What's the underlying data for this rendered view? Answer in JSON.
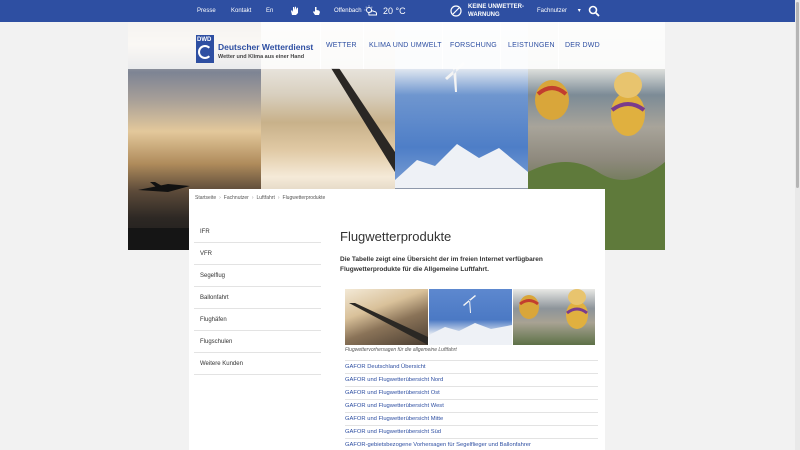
{
  "topbar": {
    "presse": "Presse",
    "kontakt": "Kontakt",
    "lang": "En",
    "city": "Offenbach",
    "temperature": "20 °C",
    "warning_line1": "KEINE UNWETTER-",
    "warning_line2": "WARNUNG",
    "role": "Fachnutzer",
    "role_caret": "▾"
  },
  "logo": {
    "mark": "DWD",
    "name": "Deutscher Wetterdienst",
    "tagline": "Wetter und Klima aus einer Hand"
  },
  "nav": [
    "WETTER",
    "KLIMA UND UMWELT",
    "FORSCHUNG",
    "LEISTUNGEN",
    "DER DWD"
  ],
  "breadcrumb": [
    "Startseite",
    "Fachnutzer",
    "Luftfahrt",
    "Flugwetterprodukte"
  ],
  "breadcrumb_sep": "›",
  "sidebar": [
    "IFR",
    "VFR",
    "Segelflug",
    "Ballonfahrt",
    "Flughäfen",
    "Flugschulen",
    "Weitere Kunden"
  ],
  "main": {
    "title": "Flugwetterprodukte",
    "intro": "Die Tabelle zeigt eine Übersicht der im freien Internet verfügbaren Flugwetterprodukte für die Allgemeine Luftfahrt.",
    "caption": "Flugwettervorhersagen für die allgemeine Luftfahrt",
    "links": [
      "GAFOR Deutschland Übersicht",
      "GAFOR und Flugwetterübersicht Nord",
      "GAFOR und Flugwetterübersicht Ost",
      "GAFOR und Flugwetterübersicht West",
      "GAFOR und Flugwetterübersicht Mitte",
      "GAFOR und Flugwetterübersicht Süd",
      "GAFOR-gebietsbezogene Vorhersagen für Segelflieger und Ballonfahrer"
    ]
  },
  "colors": {
    "brand": "#2e4fa2",
    "link": "#2e4fa2",
    "background": "#f2f2f2"
  },
  "icons": [
    "hand-icon",
    "pointer-hand-icon",
    "weather-icon",
    "no-warning-icon",
    "search-icon"
  ]
}
